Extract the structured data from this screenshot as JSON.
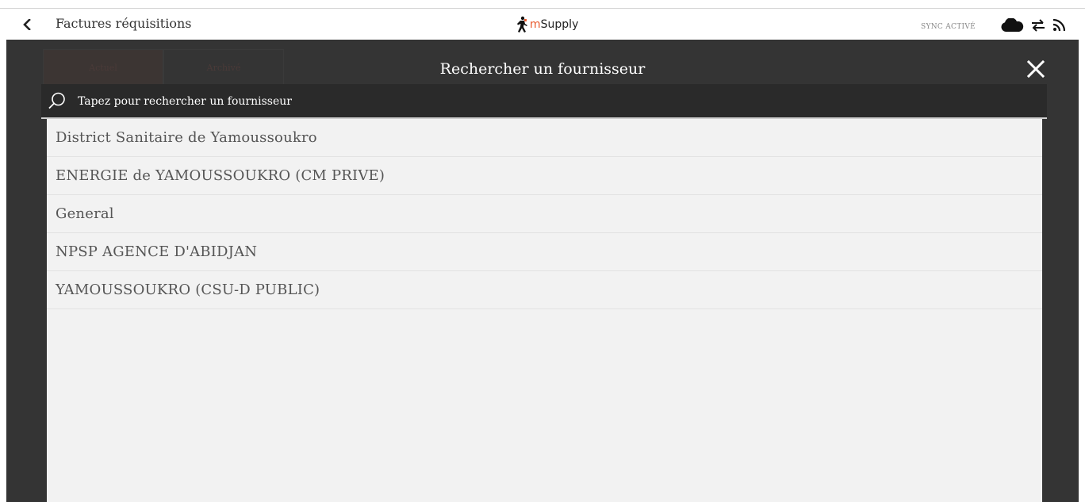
{
  "navbar": {
    "back_icon": "chevron-left-icon",
    "title": "Factures réquisitions",
    "brand": {
      "logo_icon": "msupply-logo-icon",
      "prefix": "m",
      "name": "Supply",
      "accent_color": "#e95c30"
    },
    "sync_label": "SYNC ACTIVÉ",
    "icons": [
      "cloud-icon",
      "sync-arrows-icon",
      "rss-feed-icon"
    ]
  },
  "background_tabs": [
    {
      "label": "Actuel"
    },
    {
      "label": "Archivé"
    }
  ],
  "modal": {
    "title": "Rechercher un fournisseur",
    "close_icon": "close-icon",
    "search": {
      "icon": "search-icon",
      "placeholder": "Tapez pour rechercher un fournisseur",
      "value": ""
    },
    "results": [
      {
        "label": "District Sanitaire de Yamoussoukro"
      },
      {
        "label": "ENERGIE de YAMOUSSOUKRO (CM PRIVE)"
      },
      {
        "label": "General"
      },
      {
        "label": "NPSP AGENCE D'ABIDJAN"
      },
      {
        "label": "YAMOUSSOUKRO (CSU-D PUBLIC)"
      }
    ]
  },
  "colors": {
    "modal_background": "#343434",
    "list_background": "#f2f2f2",
    "brand_accent": "#e95c30",
    "cursor": "#2aa7a0"
  }
}
